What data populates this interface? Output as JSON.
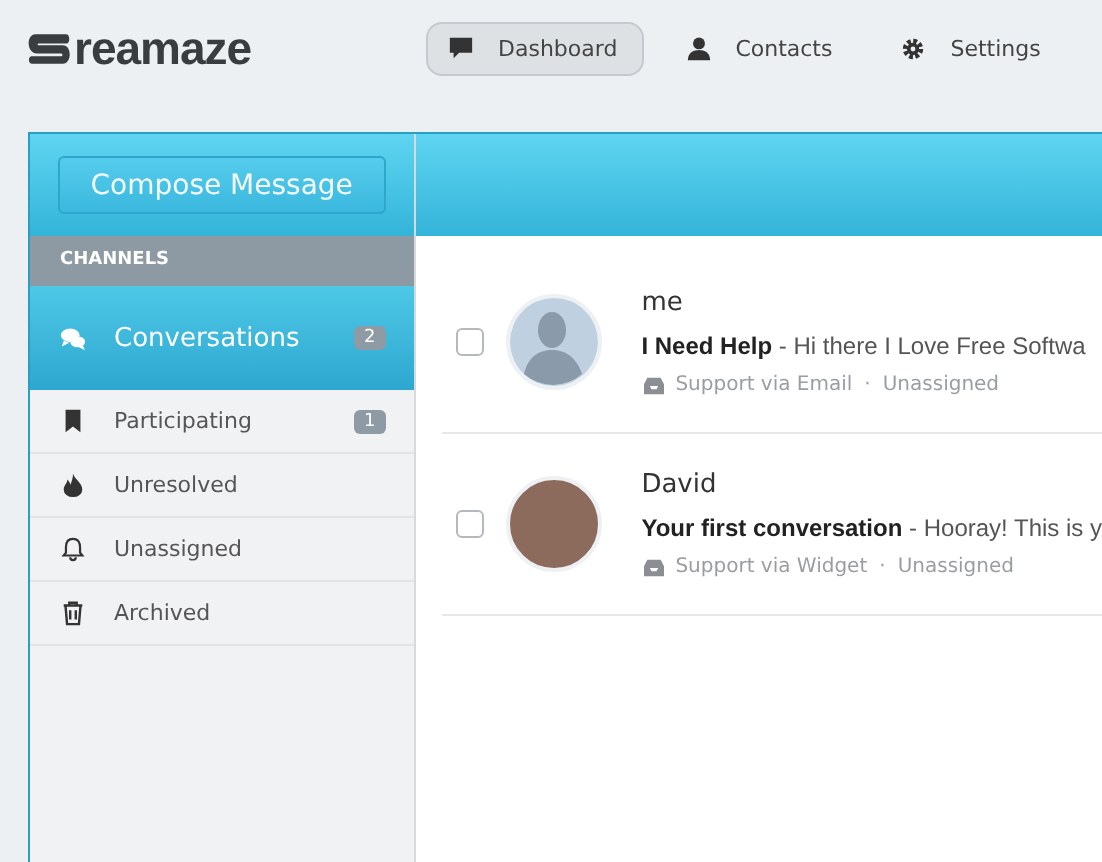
{
  "logo": {
    "text": "reamaze"
  },
  "nav": [
    {
      "label": "Dashboard",
      "selected": true
    },
    {
      "label": "Contacts",
      "selected": false
    },
    {
      "label": "Settings",
      "selected": false
    }
  ],
  "sidebar": {
    "compose_button": "Compose Message",
    "section_title": "CHANNELS",
    "items": [
      {
        "label": "Conversations",
        "count": "2",
        "selected": true
      },
      {
        "label": "Participating",
        "count": "1",
        "selected": false
      },
      {
        "label": "Unresolved",
        "selected": false
      },
      {
        "label": "Unassigned",
        "selected": false
      },
      {
        "label": "Archived",
        "selected": false
      }
    ]
  },
  "conversations": [
    {
      "name": "me",
      "checked": false,
      "summary": "**I Need Help** - Hi there I Love Free Softwa",
      "channel": "Support via Email",
      "separator": "·",
      "assignee": "Unassigned"
    },
    {
      "name": "David",
      "checked": false,
      "summary": "**Your first conversation** - Hooray! This is y",
      "channel": "Support via Widget",
      "separator": "·",
      "assignee": "Unassigned"
    }
  ]
}
